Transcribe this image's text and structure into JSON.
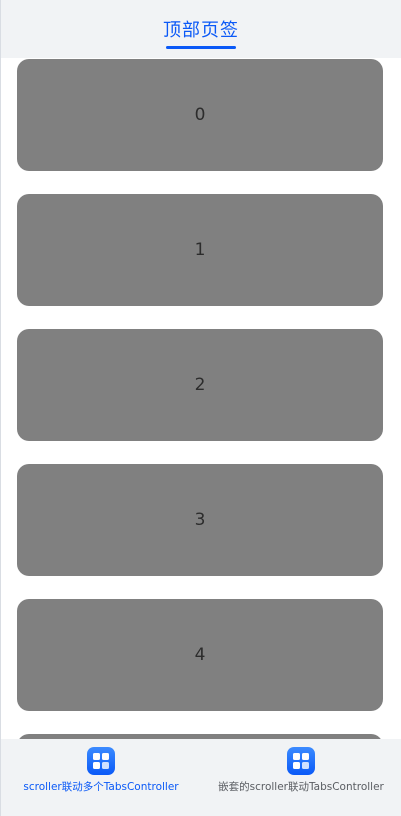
{
  "top_tabs": {
    "active_label": "顶部页签"
  },
  "list": {
    "items": [
      "0",
      "1",
      "2",
      "3",
      "4",
      ""
    ]
  },
  "bottom_tabs": {
    "items": [
      {
        "label": "scroller联动多个TabsController",
        "active": true,
        "icon": "grid-app-icon"
      },
      {
        "label": "嵌套的scroller联动TabsController",
        "active": false,
        "icon": "grid-app-icon"
      }
    ]
  },
  "colors": {
    "accent": "#0a59f7",
    "card": "#808080",
    "bar_background": "#f1f3f5"
  }
}
